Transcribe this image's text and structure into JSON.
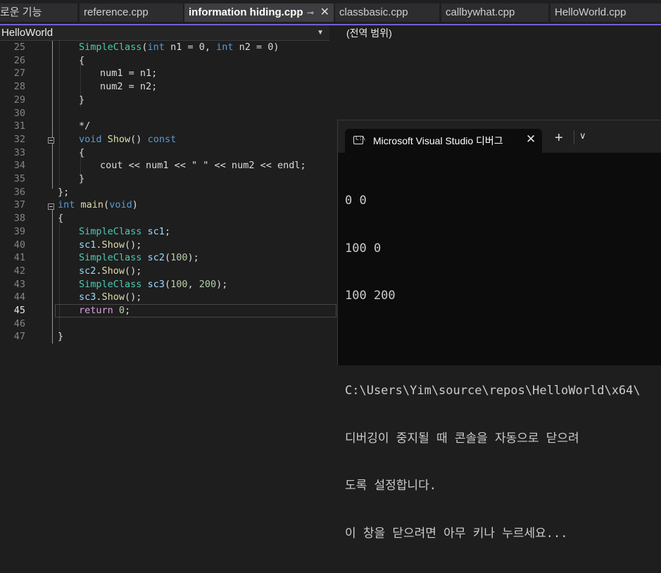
{
  "tabs": [
    {
      "label": "로운 기능"
    },
    {
      "label": "reference.cpp"
    },
    {
      "label": "information hiding.cpp",
      "pin": "⊸",
      "close": "✕"
    },
    {
      "label": "classbasic.cpp"
    },
    {
      "label": "callbywhat.cpp"
    },
    {
      "label": "HelloWorld.cpp"
    }
  ],
  "nav": {
    "project": "HelloWorld",
    "dropdown_arrow": "▼",
    "scope": "(전역 범위)"
  },
  "editor": {
    "current_line": "45",
    "lines": [
      {
        "n": "25",
        "tokens": [
          [
            "ty",
            "SimpleClass"
          ],
          [
            "tx",
            "("
          ],
          [
            "kw",
            "int"
          ],
          [
            "tx",
            " n1 = 0, "
          ],
          [
            "kw",
            "int"
          ],
          [
            "tx",
            " n2 = 0)"
          ]
        ]
      },
      {
        "n": "26",
        "tokens": [
          [
            "tx",
            "{"
          ]
        ]
      },
      {
        "n": "27",
        "tokens": [
          [
            "tx",
            "num1 = n1;"
          ]
        ]
      },
      {
        "n": "28",
        "tokens": [
          [
            "tx",
            "num2 = n2;"
          ]
        ]
      },
      {
        "n": "29",
        "tokens": [
          [
            "tx",
            "}"
          ]
        ]
      },
      {
        "n": "30",
        "tokens": []
      },
      {
        "n": "31",
        "tokens": [
          [
            "tx",
            "*/"
          ]
        ]
      },
      {
        "n": "32",
        "tokens": [
          [
            "kw",
            "void"
          ],
          [
            "tx",
            " "
          ],
          [
            "fn",
            "Show"
          ],
          [
            "tx",
            "() "
          ],
          [
            "kw",
            "const"
          ]
        ]
      },
      {
        "n": "33",
        "tokens": [
          [
            "tx",
            "{"
          ]
        ]
      },
      {
        "n": "34",
        "tokens": [
          [
            "tx",
            "cout << num1 << \" \" << num2 << endl;"
          ]
        ]
      },
      {
        "n": "35",
        "tokens": [
          [
            "tx",
            "}"
          ]
        ]
      },
      {
        "n": "36",
        "tokens": [
          [
            "tx",
            "};"
          ]
        ]
      },
      {
        "n": "37",
        "tokens": [
          [
            "kw",
            "int"
          ],
          [
            "tx",
            " "
          ],
          [
            "fn",
            "main"
          ],
          [
            "tx",
            "("
          ],
          [
            "kw",
            "void"
          ],
          [
            "tx",
            ")"
          ]
        ]
      },
      {
        "n": "38",
        "tokens": [
          [
            "tx",
            "{"
          ]
        ]
      },
      {
        "n": "39",
        "tokens": [
          [
            "ty",
            "SimpleClass"
          ],
          [
            "tx",
            " "
          ],
          [
            "vr",
            "sc1"
          ],
          [
            "tx",
            ";"
          ]
        ]
      },
      {
        "n": "40",
        "tokens": [
          [
            "vr",
            "sc1"
          ],
          [
            "tx",
            "."
          ],
          [
            "fn",
            "Show"
          ],
          [
            "tx",
            "();"
          ]
        ]
      },
      {
        "n": "41",
        "tokens": [
          [
            "ty",
            "SimpleClass"
          ],
          [
            "tx",
            " "
          ],
          [
            "vr",
            "sc2"
          ],
          [
            "tx",
            "("
          ],
          [
            "nm",
            "100"
          ],
          [
            "tx",
            ");"
          ]
        ]
      },
      {
        "n": "42",
        "tokens": [
          [
            "vr",
            "sc2"
          ],
          [
            "tx",
            "."
          ],
          [
            "fn",
            "Show"
          ],
          [
            "tx",
            "();"
          ]
        ]
      },
      {
        "n": "43",
        "tokens": [
          [
            "ty",
            "SimpleClass"
          ],
          [
            "tx",
            " "
          ],
          [
            "vr",
            "sc3"
          ],
          [
            "tx",
            "("
          ],
          [
            "nm",
            "100"
          ],
          [
            "tx",
            ", "
          ],
          [
            "nm",
            "200"
          ],
          [
            "tx",
            ");"
          ]
        ]
      },
      {
        "n": "44",
        "tokens": [
          [
            "vr",
            "sc3"
          ],
          [
            "tx",
            "."
          ],
          [
            "fn",
            "Show"
          ],
          [
            "tx",
            "();"
          ]
        ]
      },
      {
        "n": "45",
        "tokens": [
          [
            "pk",
            "return"
          ],
          [
            "tx",
            " "
          ],
          [
            "nm",
            "0"
          ],
          [
            "tx",
            ";"
          ]
        ]
      },
      {
        "n": "46",
        "tokens": []
      },
      {
        "n": "47",
        "tokens": [
          [
            "tx",
            "}"
          ]
        ]
      }
    ]
  },
  "console": {
    "title": "Microsoft Visual Studio 디버그",
    "icon_text": "C:\\",
    "close": "✕",
    "plus": "+",
    "dropdown": "⌄",
    "output": [
      "0 0",
      "100 0",
      "100 200",
      "",
      "C:\\Users\\Yim\\source\\repos\\HelloWorld\\x64\\",
      "디버깅이 중지될 때 콘솔을 자동으로 닫으려",
      "도록 설정합니다.",
      "이 창을 닫으려면 아무 키나 누르세요..."
    ]
  },
  "colors": {
    "keyword": "#569cd6",
    "type": "#4ec9b0",
    "comment": "#57a64a",
    "function": "#dcdcaa",
    "accent": "#7161d6"
  }
}
